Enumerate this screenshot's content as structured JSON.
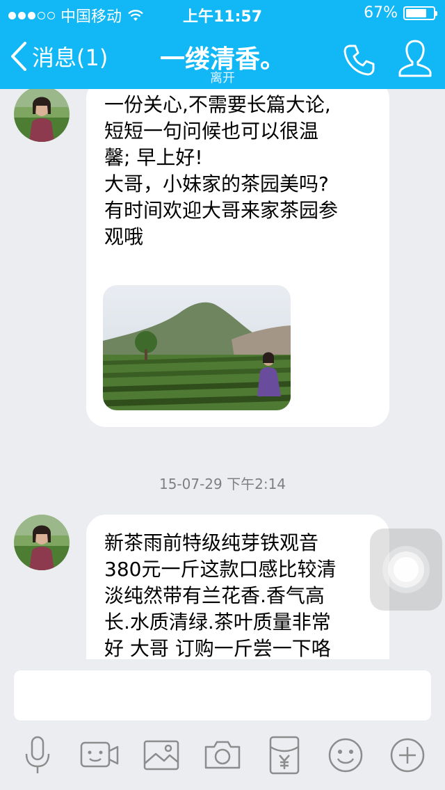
{
  "status_bar": {
    "carrier": "中国移动",
    "time": "上午11:57",
    "battery": "67%",
    "battery_level": 0.67,
    "signal_strength": "3 of 5"
  },
  "nav": {
    "back_label": "消息(1)",
    "title": "一缕清香。",
    "subtitle": "离开"
  },
  "messages": [
    {
      "text": "一份关心,不需要长篇大论,\n短短一句问候也可以很温\n馨; 早上好!\n大哥，小妹家的茶园美吗?\n有时间欢迎大哥来家茶园参\n观哦"
    },
    {
      "text": "新茶雨前特级纯芽铁观音\n380元一斤这款口感比较清\n淡纯然带有兰花香.香气高\n长.水质清绿.茶叶质量非常\n好 大哥 订购一斤尝一下咯"
    }
  ],
  "timestamp": "15-07-29 下午2:14",
  "input": {
    "placeholder": ""
  },
  "toolbar": {
    "icons": [
      "microphone-icon",
      "video-icon",
      "image-icon",
      "camera-icon",
      "red-packet-icon",
      "emoji-icon",
      "plus-icon"
    ]
  },
  "colors": {
    "header": "#12b7f5",
    "background": "#ebedf0",
    "bubble": "#ffffff",
    "toolbar_icon": "#8c8c8c"
  }
}
